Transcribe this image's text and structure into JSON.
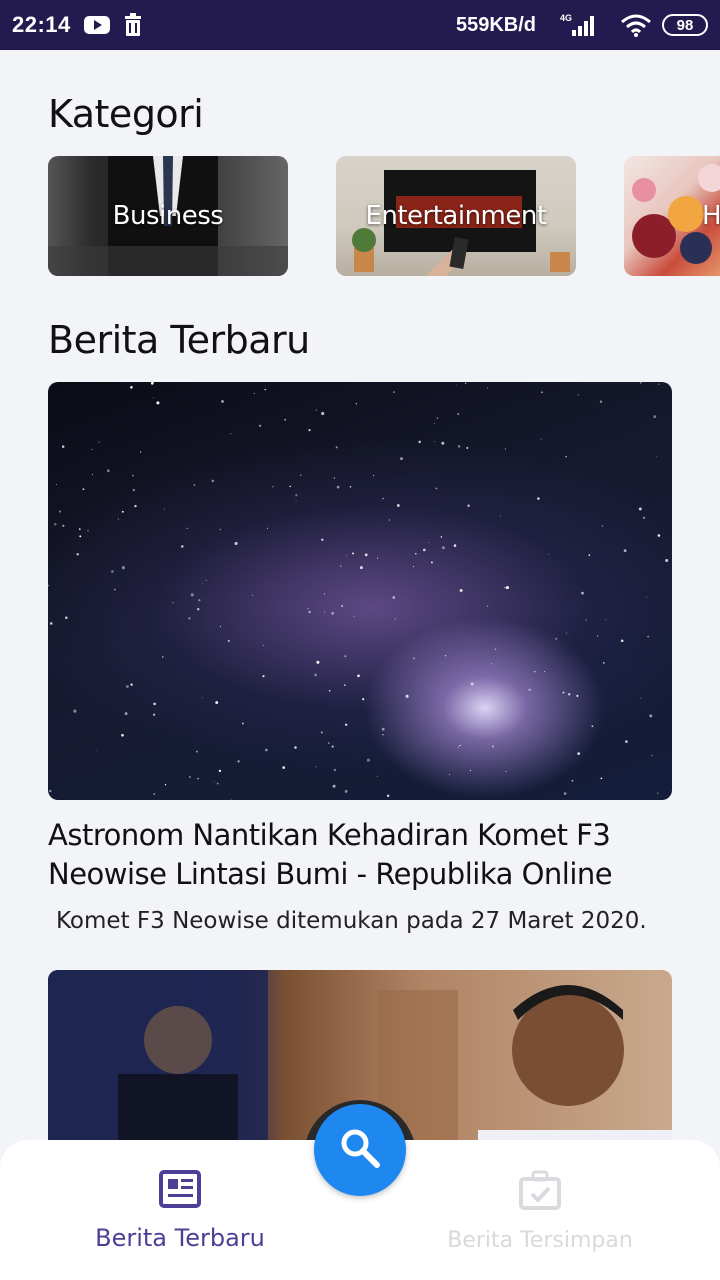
{
  "status_bar": {
    "time": "22:14",
    "network_speed": "559KB/d",
    "network_type": "4G",
    "battery": "98",
    "icons": [
      "youtube-icon",
      "trash-icon",
      "signal-icon",
      "wifi-icon",
      "battery-icon"
    ]
  },
  "sections": {
    "kategori_title": "Kategori",
    "berita_title": "Berita Terbaru"
  },
  "categories": [
    {
      "label": "Business"
    },
    {
      "label": "Entertainment"
    },
    {
      "label": "H"
    }
  ],
  "articles": [
    {
      "title": "Astronom Nantikan Kehadiran Komet F3 Neowise Lintasi Bumi - Republika Online",
      "description": "Komet F3 Neowise ditemukan pada 27 Maret 2020."
    }
  ],
  "bottom_nav": {
    "items": [
      {
        "label": "Berita Terbaru",
        "active": true,
        "icon": "newspaper-icon"
      },
      {
        "label": "Berita Tersimpan",
        "active": false,
        "icon": "saved-briefcase-icon"
      }
    ],
    "fab_icon": "search-icon"
  },
  "colors": {
    "status_bar": "#231a4f",
    "accent": "#4b3f96",
    "fab": "#1e88f0",
    "background": "#f3f4f8"
  }
}
